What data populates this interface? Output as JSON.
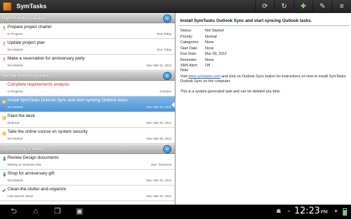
{
  "app": {
    "title": "SymTasks"
  },
  "actionbar": {
    "icons": [
      "refresh-icon-1",
      "refresh-icon-2",
      "add-task-icon",
      "edit-task-icon",
      "menu-icon"
    ]
  },
  "sections": [
    {
      "title": "High Priority (3 tasks)",
      "tasks": [
        {
          "icon": "!",
          "title": "Prepare project charter",
          "status": "In Progress",
          "due": "Due Today",
          "selected": false,
          "overdue": false
        },
        {
          "icon": "!",
          "title": "Update project plan",
          "status": "Not Started",
          "due": "Due Today",
          "selected": false,
          "overdue": false
        },
        {
          "icon": "!",
          "title": "Make a reservation for anniversary party",
          "status": "Not Started",
          "due": "Due: Mar 01, 2012",
          "selected": false,
          "overdue": false
        }
      ]
    },
    {
      "title": "Normal Priority (4 tasks)",
      "tasks": [
        {
          "icon": "",
          "title": "Complete requirements analysis",
          "status": "In Progress",
          "due": "Overdue",
          "selected": false,
          "overdue": true
        },
        {
          "icon": "dot",
          "title": "Install SymTasks Outlook Sync and start syncing Outlook tasks.",
          "status": "Not Started",
          "due": "Due: Mar 09, 2012",
          "selected": true,
          "overdue": false
        },
        {
          "icon": "dot",
          "title": "Paint the deck",
          "status": "Deferred",
          "due": "Due: Mar 05, 2012",
          "selected": false,
          "overdue": false
        },
        {
          "icon": "dot",
          "title": "Take the online course on system security",
          "status": "Not Started",
          "due": "Due: Mar 05, 2012",
          "selected": false,
          "overdue": false
        }
      ]
    },
    {
      "title": "Low Priority (3 tasks)",
      "tasks": [
        {
          "icon": "down",
          "title": "Review Design documents",
          "status": "Waiting on someone else",
          "due": "Due: Tomorrow",
          "selected": false,
          "overdue": false
        },
        {
          "icon": "down",
          "title": "Shop for anniversary gift",
          "status": "Not Started",
          "due": "Due: Mar 01, 2012",
          "selected": false,
          "overdue": false
        },
        {
          "icon": "check",
          "title": "Clean-the-clutter-and-organize",
          "status": "Last synced: Never",
          "due": "Due: Mar 01, 2012",
          "selected": false,
          "overdue": false
        }
      ]
    }
  ],
  "detail": {
    "title": "Install SymTasks Outlook Sync and start syncing Outlook tasks.",
    "fields": [
      {
        "label": "Status:",
        "value": "Not Started"
      },
      {
        "label": "Priority:",
        "value": "Normal"
      },
      {
        "label": "Categories:",
        "value": "None"
      },
      {
        "label": "Start Date:",
        "value": "None"
      },
      {
        "label": "Due Date:",
        "value": "Mar 09, 2012"
      },
      {
        "label": "Reminder:",
        "value": "None"
      },
      {
        "label": "SMS Alert:",
        "value": "Off"
      }
    ],
    "note_label": "Note:",
    "note_prefix": "Visit ",
    "note_link": "www.symtasks.com",
    "note_suffix": " and click on Outlook Sync button for instructions on how to install SymTasks Outlook Sync on the computer.",
    "note_footer": "This is a system generated task and can be deleted any time."
  },
  "sysbar": {
    "clock": "12:23",
    "ampm": "PM"
  },
  "colors": {
    "selected": "#4c93d6",
    "overdue": "#d0251a",
    "high_priority": "#d11a1a",
    "low_priority": "#1a78c7"
  }
}
